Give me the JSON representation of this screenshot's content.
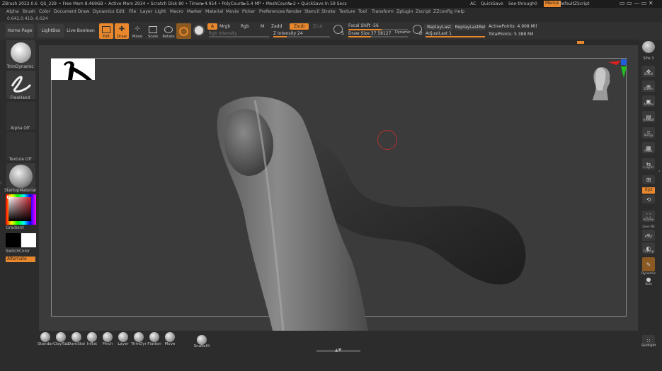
{
  "titlebar": {
    "app": "ZBrush 2022.0.6",
    "doc": "QS_229",
    "stats": "• Free Mem 8.469GB • Active Mem 2934 • Scratch Disk 80 • Timer►4.954 • PolyCount►5.4 MP • MeshCount►2 • QuickSave In 59 Secs",
    "ac": "AC",
    "quicksave": "QuickSave",
    "seethrough": "See-through",
    "seethrough_val": "0",
    "menus": "Menus",
    "defaultscript": "DefaultZScript"
  },
  "menu": [
    "Alpha",
    "Brush",
    "Color",
    "Document",
    "Draw",
    "Dynamics",
    "Edit",
    "File",
    "Layer",
    "Light",
    "Macro",
    "Marker",
    "Material",
    "Movie",
    "Picker",
    "Preferences",
    "Render",
    "Stencil",
    "Stroke",
    "Texture",
    "Tool",
    "Transform",
    "Zplugin",
    "Zscript",
    "ZZconfig",
    "Help"
  ],
  "coords": "0.642,0.419,-0.024",
  "toolbar": {
    "home": "Home Page",
    "lightbox": "LightBox",
    "livebool": "Live Boolean",
    "edit": "Edit",
    "draw": "Draw",
    "move": "Move",
    "scale": "Scale",
    "rotate": "Rotate",
    "a": "A",
    "mrgb": "Mrgb",
    "rgb": "Rgb",
    "m": "M",
    "zadd": "Zadd",
    "zsub": "Zsub",
    "zcut": "Zcut",
    "rgb_intensity": "Rgb Intensity",
    "z_intensity": "Z Intensity 24",
    "focal_shift": "Focal Shift -56",
    "draw_size": "Draw Size 37.58127",
    "dynamic": "Dynamic",
    "replaylast": "ReplayLast",
    "replaylastrel": "ReplayLastRel",
    "adjustlast": "AdjustLast 1",
    "activepoints": "ActivePoints: 4.908 Mil",
    "totalpoints": "TotalPoints: 5.388 Mil",
    "s_label": "S",
    "d_label": "D",
    "z_intensity_value": 0.24,
    "focal_shift_value": -0.56,
    "draw_size_value": 0.376
  },
  "left": {
    "trim": "TrimDynamic",
    "freehand": "FreeHand",
    "alpha": "Alpha Off",
    "texture": "Texture Off",
    "material": "StartupMaterial",
    "gradient": "Gradient",
    "switchcolor": "SwitchColor",
    "alternate": "Alternate"
  },
  "right": [
    "BPR",
    "SPix 3",
    "Scroll",
    "Zoom",
    "Actual",
    "AAHalf",
    "Persp",
    "Floor",
    "L.Sym",
    "Frame",
    "Move",
    "Polyf",
    "Line Fill",
    "Transp",
    "Dynamic",
    "Solo",
    "Xyz",
    "Spotlight"
  ],
  "bottom": [
    "Standar",
    "ClayTub",
    "DamStai",
    "Inflat",
    "Pinch",
    "Layer",
    "TrimDyr",
    "Flatten",
    "Move",
    "SnakeHi"
  ],
  "colors": {
    "accent": "#e8872c",
    "viewport": "#3b3b3b"
  }
}
